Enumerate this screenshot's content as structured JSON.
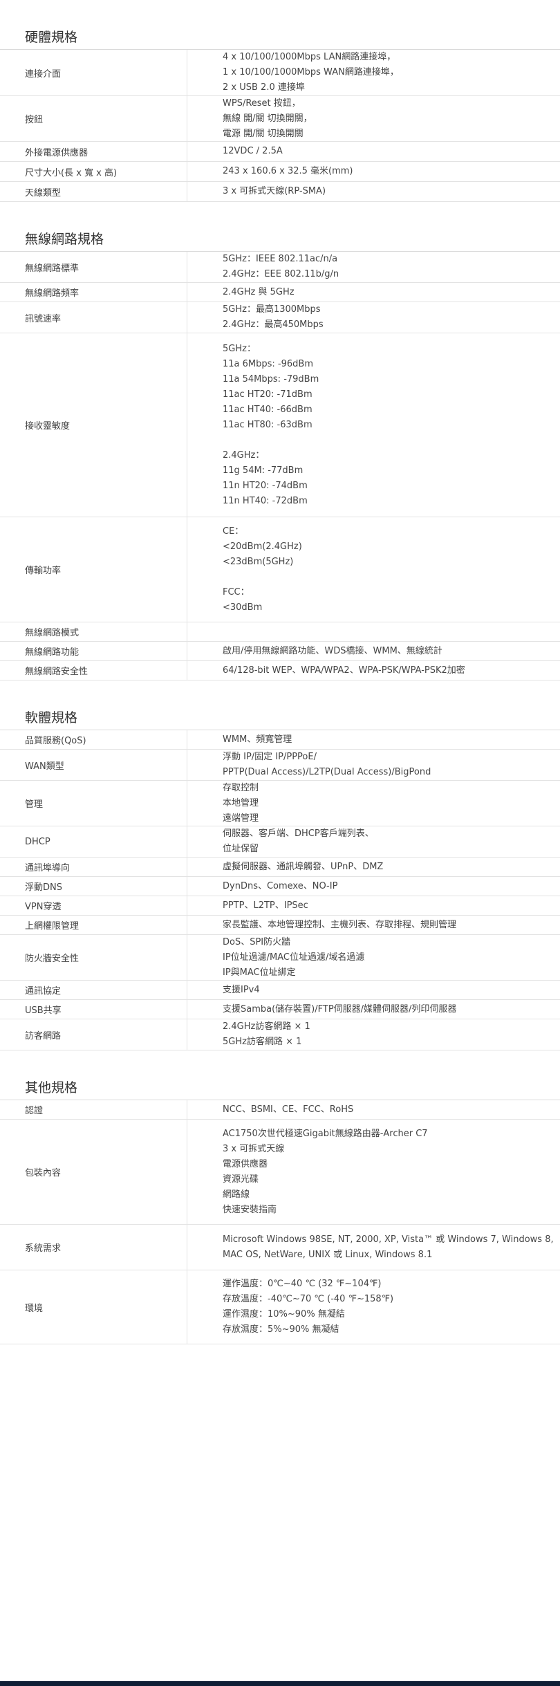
{
  "sections": [
    {
      "title": "硬體規格",
      "rows": [
        {
          "label": "連接介面",
          "value": "4 x 10/100/1000Mbps LAN網路連接埠，\n1 x 10/100/1000Mbps WAN網路連接埠，\n2 x USB 2.0 連接埠"
        },
        {
          "label": "按鈕",
          "value": "WPS/Reset 按鈕，\n無線 開/關 切換開關，\n電源 開/關 切換開關"
        },
        {
          "label": "外接電源供應器",
          "value": "12VDC / 2.5A"
        },
        {
          "label": "尺寸大小(長 x 寬 x 高)",
          "value": "243 x 160.6 x 32.5 毫米(mm)"
        },
        {
          "label": "天線類型",
          "value": "3 x 可拆式天線(RP-SMA)"
        }
      ]
    },
    {
      "title": "無線網路規格",
      "rows": [
        {
          "label": "無線網路標準",
          "value": "5GHz：IEEE 802.11ac/n/a\n2.4GHz：EEE 802.11b/g/n"
        },
        {
          "label": "無線網路頻率",
          "value": "2.4GHz 與 5GHz"
        },
        {
          "label": "訊號速率",
          "value": "5GHz：最高1300Mbps\n2.4GHz：最高450Mbps"
        },
        {
          "label": "接收靈敏度",
          "value": "5GHz：\n11a 6Mbps: -96dBm\n11a 54Mbps: -79dBm\n11ac HT20: -71dBm\n11ac HT40: -66dBm\n11ac HT80: -63dBm\n\n2.4GHz：\n11g 54M: -77dBm\n11n HT20: -74dBm\n11n HT40: -72dBm"
        },
        {
          "label": "傳輸功率",
          "value": "CE：\n<20dBm(2.4GHz)\n<23dBm(5GHz)\n\nFCC：\n<30dBm"
        },
        {
          "label": "無線網路模式",
          "value": ""
        },
        {
          "label": "無線網路功能",
          "value": "啟用/停用無線網路功能、WDS橋接、WMM、無線統計"
        },
        {
          "label": "無線網路安全性",
          "value": "64/128-bit WEP、WPA/WPA2、WPA-PSK/WPA-PSK2加密"
        }
      ]
    },
    {
      "title": "軟體規格",
      "rows": [
        {
          "label": "品質服務(QoS)",
          "value": "WMM、頻寬管理"
        },
        {
          "label": "WAN類型",
          "value": "浮動 IP/固定 IP/PPPoE/\nPPTP(Dual Access)/L2TP(Dual Access)/BigPond"
        },
        {
          "label": "管理",
          "value": "存取控制\n本地管理\n遠端管理"
        },
        {
          "label": "DHCP",
          "value": "伺服器、客戶端、DHCP客戶端列表、\n位址保留"
        },
        {
          "label": "通訊埠導向",
          "value": "虛擬伺服器、通訊埠觸發、UPnP、DMZ"
        },
        {
          "label": "浮動DNS",
          "value": "DynDns、Comexe、NO-IP"
        },
        {
          "label": "VPN穿透",
          "value": "PPTP、L2TP、IPSec"
        },
        {
          "label": "上網權限管理",
          "value": "家長監護、本地管理控制、主機列表、存取排程、規則管理"
        },
        {
          "label": "防火牆安全性",
          "value": "DoS、SPI防火牆\nIP位址過濾/MAC位址過濾/域名過濾\nIP與MAC位址綁定"
        },
        {
          "label": "通訊協定",
          "value": "支援IPv4"
        },
        {
          "label": "USB共享",
          "value": "支援Samba(儲存裝置)/FTP伺服器/媒體伺服器/列印伺服器"
        },
        {
          "label": "訪客網路",
          "value": "2.4GHz訪客網路 × 1\n5GHz訪客網路 × 1"
        }
      ]
    },
    {
      "title": "其他規格",
      "rows": [
        {
          "label": "認證",
          "value": "NCC、BSMI、CE、FCC、RoHS"
        },
        {
          "label": "包裝內容",
          "value": "AC1750次世代極速Gigabit無線路由器-Archer C7\n3 x 可拆式天線\n電源供應器\n資源光碟\n網路線\n快速安裝指南"
        },
        {
          "label": "系統需求",
          "value": "Microsoft Windows 98SE, NT, 2000, XP, Vista™ 或 Windows 7, Windows 8,\nMAC OS, NetWare, UNIX 或 Linux, Windows 8.1"
        },
        {
          "label": "環境",
          "value": "運作溫度：0℃~40 ℃ (32 ℉~104℉)\n存放溫度：-40℃~70 ℃ (-40 ℉~158℉)\n運作濕度：10%~90% 無凝結\n存放濕度：5%~90% 無凝結"
        }
      ]
    }
  ]
}
